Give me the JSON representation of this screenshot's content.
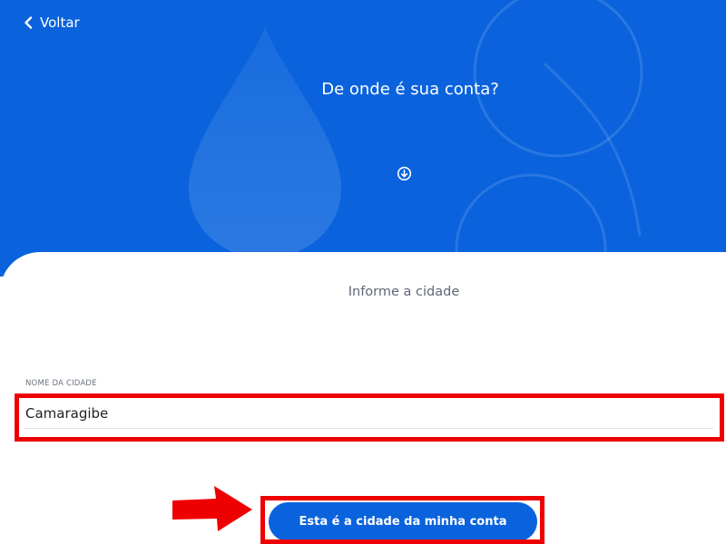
{
  "header": {
    "back_label": "Voltar",
    "title": "De onde é sua conta?"
  },
  "panel": {
    "subtitle": "Informe a cidade"
  },
  "form": {
    "city_label": "NOME DA CIDADE",
    "city_value": "Camaragibe"
  },
  "actions": {
    "confirm_label": "Esta é a cidade da minha conta"
  },
  "icons": {
    "back": "chevron-left-icon",
    "scroll_down": "arrow-down-circle-icon",
    "pointer": "red-arrow-icon"
  },
  "colors": {
    "brand_blue": "#0a63dd",
    "highlight_red": "#ee0000",
    "panel_white": "#ffffff"
  }
}
